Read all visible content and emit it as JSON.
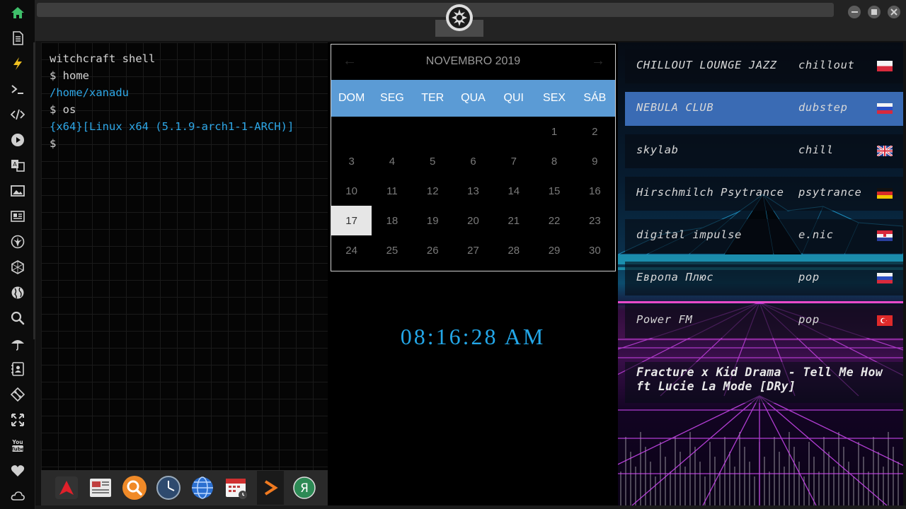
{
  "sidebar": {
    "items": [
      {
        "icon": "home-icon",
        "color": "#3fbf6a"
      },
      {
        "icon": "document-icon",
        "color": "#cfcfcf"
      },
      {
        "icon": "lightning-icon",
        "color": "#f0c020"
      },
      {
        "icon": "terminal-icon",
        "color": "#cfcfcf"
      },
      {
        "icon": "code-icon",
        "color": "#cfcfcf"
      },
      {
        "icon": "play-icon",
        "color": "#cfcfcf"
      },
      {
        "icon": "translate-icon",
        "color": "#cfcfcf"
      },
      {
        "icon": "image-icon",
        "color": "#cfcfcf"
      },
      {
        "icon": "news-icon",
        "color": "#cfcfcf"
      },
      {
        "icon": "rebel-alliance-icon",
        "color": "#cfcfcf"
      },
      {
        "icon": "hexagon-icon",
        "color": "#cfcfcf"
      },
      {
        "icon": "globe-icon",
        "color": "#cfcfcf"
      },
      {
        "icon": "search-icon",
        "color": "#cfcfcf"
      },
      {
        "icon": "umbrella-icon",
        "color": "#cfcfcf"
      },
      {
        "icon": "contacts-icon",
        "color": "#cfcfcf"
      },
      {
        "icon": "git-icon",
        "color": "#cfcfcf"
      },
      {
        "icon": "expand-icon",
        "color": "#cfcfcf"
      },
      {
        "icon": "youtube-icon",
        "color": "#cfcfcf"
      },
      {
        "icon": "heart-icon",
        "color": "#cfcfcf"
      },
      {
        "icon": "cloud-icon",
        "color": "#cfcfcf"
      }
    ]
  },
  "topbar": {
    "logo": "galactic-empire-icon",
    "buttons": [
      "minimize-icon",
      "maximize-icon",
      "close-icon"
    ]
  },
  "terminal": {
    "lines": [
      {
        "text": "witchcraft shell",
        "style": "white"
      },
      {
        "text": "$ home",
        "style": "white"
      },
      {
        "text": "/home/xanadu",
        "style": "blue"
      },
      {
        "text": "$ os",
        "style": "white"
      },
      {
        "text": "{x64}[Linux x64 (5.1.9-arch1-1-ARCH)]",
        "style": "blue"
      },
      {
        "text": "$",
        "style": "white"
      }
    ]
  },
  "dock": {
    "items": [
      {
        "icon": "arch-app-icon",
        "active": false
      },
      {
        "icon": "news-reader-icon",
        "active": false
      },
      {
        "icon": "magnifier-app-icon",
        "active": false
      },
      {
        "icon": "clock-app-icon",
        "active": false
      },
      {
        "icon": "browser-globe-icon",
        "active": false
      },
      {
        "icon": "calendar-app-icon",
        "active": false
      },
      {
        "icon": "terminal-app-icon",
        "active": true
      },
      {
        "icon": "yandex-app-icon",
        "active": false
      }
    ]
  },
  "calendar": {
    "month_label": "NOVEMBRO 2019",
    "prev": "←",
    "next": "→",
    "weekdays": [
      "DOM",
      "SEG",
      "TER",
      "QUA",
      "QUI",
      "SEX",
      "SÁB"
    ],
    "days": [
      "",
      "",
      "",
      "",
      "",
      "1",
      "2",
      "3",
      "4",
      "5",
      "6",
      "7",
      "8",
      "9",
      "10",
      "11",
      "12",
      "13",
      "14",
      "15",
      "16",
      "17",
      "18",
      "19",
      "20",
      "21",
      "22",
      "23",
      "24",
      "25",
      "26",
      "27",
      "28",
      "29",
      "30"
    ],
    "today": "17",
    "header_color": "#5b9bd5"
  },
  "clock": {
    "time": "08:16:28 AM",
    "color": "#23a7e8"
  },
  "radio": {
    "stations": [
      {
        "name": "CHILLOUT LOUNGE JAZZ",
        "genre": "chillout",
        "flag": "poland-flag-icon",
        "active": false
      },
      {
        "name": "NEBULA CLUB",
        "genre": "dubstep",
        "flag": "russia-flag-icon",
        "active": true
      },
      {
        "name": "skylab",
        "genre": "chill",
        "flag": "uk-flag-icon",
        "active": false
      },
      {
        "name": "Hirschmilch Psytrance",
        "genre": "psytrance",
        "flag": "germany-flag-icon",
        "active": false
      },
      {
        "name": "digital impulse",
        "genre": "e.nic",
        "flag": "croatia-flag-icon",
        "active": false
      },
      {
        "name": "Европа Плюс",
        "genre": "pop",
        "flag": "russia-flag-icon",
        "active": false
      },
      {
        "name": "Power FM",
        "genre": "pop",
        "flag": "turkey-flag-icon",
        "active": false
      }
    ],
    "now_playing": [
      "Fracture x Kid Drama - Tell Me How",
      "ft Lucie La Mode [DRy]"
    ]
  }
}
